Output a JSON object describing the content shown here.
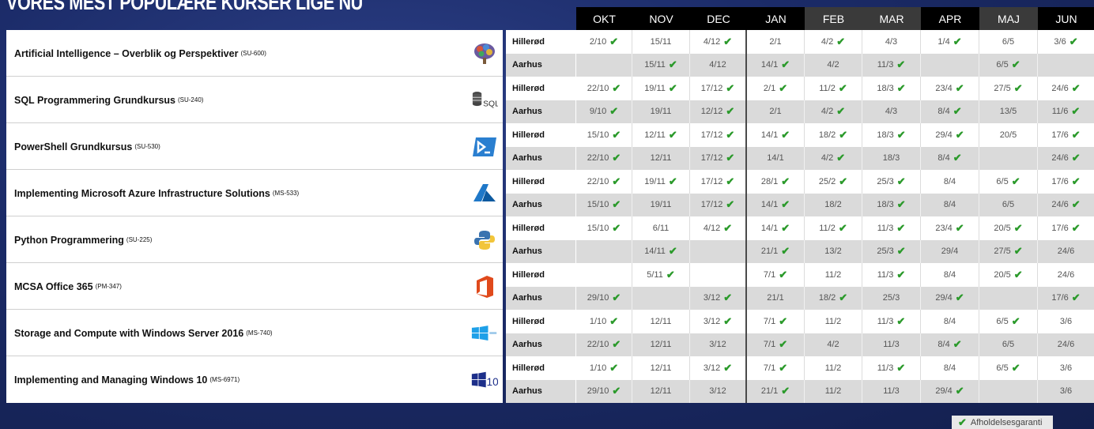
{
  "title": "VORES MEST POPULÆRE KURSER LIGE NU",
  "months": [
    "OKT",
    "NOV",
    "DEC",
    "JAN",
    "FEB",
    "MAR",
    "APR",
    "MAJ",
    "JUN"
  ],
  "check_color": "#2b9a2b",
  "courses": [
    {
      "name": "Artificial Intelligence – Overblik og Perspektiver",
      "code": "(SU-600)",
      "icon": "brain-icon",
      "rows": [
        {
          "loc": "Hillerød",
          "cells": [
            {
              "d": "2/10",
              "c": true
            },
            {
              "d": "15/11",
              "c": false
            },
            {
              "d": "4/12",
              "c": true
            },
            {
              "d": "2/1",
              "c": false
            },
            {
              "d": "4/2",
              "c": true
            },
            {
              "d": "4/3",
              "c": false
            },
            {
              "d": "1/4",
              "c": true
            },
            {
              "d": "6/5",
              "c": false
            },
            {
              "d": "3/6",
              "c": true
            }
          ]
        },
        {
          "loc": "Aarhus",
          "cells": [
            {
              "d": "",
              "c": false
            },
            {
              "d": "15/11",
              "c": true
            },
            {
              "d": "4/12",
              "c": false
            },
            {
              "d": "14/1",
              "c": true
            },
            {
              "d": "4/2",
              "c": false
            },
            {
              "d": "11/3",
              "c": true
            },
            {
              "d": "",
              "c": false
            },
            {
              "d": "6/5",
              "c": true
            },
            {
              "d": "",
              "c": false
            }
          ]
        }
      ]
    },
    {
      "name": "SQL Programmering Grundkursus",
      "code": "(SU-240)",
      "icon": "sql-database-icon",
      "rows": [
        {
          "loc": "Hillerød",
          "cells": [
            {
              "d": "22/10",
              "c": true
            },
            {
              "d": "19/11",
              "c": true
            },
            {
              "d": "17/12",
              "c": true
            },
            {
              "d": "2/1",
              "c": true
            },
            {
              "d": "11/2",
              "c": true
            },
            {
              "d": "18/3",
              "c": true
            },
            {
              "d": "23/4",
              "c": true
            },
            {
              "d": "27/5",
              "c": true
            },
            {
              "d": "24/6",
              "c": true
            }
          ]
        },
        {
          "loc": "Aarhus",
          "cells": [
            {
              "d": "9/10",
              "c": true
            },
            {
              "d": "19/11",
              "c": false
            },
            {
              "d": "12/12",
              "c": true
            },
            {
              "d": "2/1",
              "c": false
            },
            {
              "d": "4/2",
              "c": true
            },
            {
              "d": "4/3",
              "c": false
            },
            {
              "d": "8/4",
              "c": true
            },
            {
              "d": "13/5",
              "c": false
            },
            {
              "d": "11/6",
              "c": true
            }
          ]
        }
      ]
    },
    {
      "name": "PowerShell Grundkursus",
      "code": "(SU-530)",
      "icon": "powershell-icon",
      "rows": [
        {
          "loc": "Hillerød",
          "cells": [
            {
              "d": "15/10",
              "c": true
            },
            {
              "d": "12/11",
              "c": true
            },
            {
              "d": "17/12",
              "c": true
            },
            {
              "d": "14/1",
              "c": true
            },
            {
              "d": "18/2",
              "c": true
            },
            {
              "d": "18/3",
              "c": true
            },
            {
              "d": "29/4",
              "c": true
            },
            {
              "d": "20/5",
              "c": false
            },
            {
              "d": "17/6",
              "c": true
            }
          ]
        },
        {
          "loc": "Aarhus",
          "cells": [
            {
              "d": "22/10",
              "c": true
            },
            {
              "d": "12/11",
              "c": false
            },
            {
              "d": "17/12",
              "c": true
            },
            {
              "d": "14/1",
              "c": false
            },
            {
              "d": "4/2",
              "c": true
            },
            {
              "d": "18/3",
              "c": false
            },
            {
              "d": "8/4",
              "c": true
            },
            {
              "d": "",
              "c": false
            },
            {
              "d": "24/6",
              "c": true
            }
          ]
        }
      ]
    },
    {
      "name": "Implementing Microsoft Azure Infrastructure Solutions",
      "code": "(MS-533)",
      "icon": "azure-icon",
      "rows": [
        {
          "loc": "Hillerød",
          "cells": [
            {
              "d": "22/10",
              "c": true
            },
            {
              "d": "19/11",
              "c": true
            },
            {
              "d": "17/12",
              "c": true
            },
            {
              "d": "28/1",
              "c": true
            },
            {
              "d": "25/2",
              "c": true
            },
            {
              "d": "25/3",
              "c": true
            },
            {
              "d": "8/4",
              "c": false
            },
            {
              "d": "6/5",
              "c": true
            },
            {
              "d": "17/6",
              "c": true
            }
          ]
        },
        {
          "loc": "Aarhus",
          "cells": [
            {
              "d": "15/10",
              "c": true
            },
            {
              "d": "19/11",
              "c": false
            },
            {
              "d": "17/12",
              "c": true
            },
            {
              "d": "14/1",
              "c": true
            },
            {
              "d": "18/2",
              "c": false
            },
            {
              "d": "18/3",
              "c": true
            },
            {
              "d": "8/4",
              "c": false
            },
            {
              "d": "6/5",
              "c": false
            },
            {
              "d": "24/6",
              "c": true
            }
          ]
        }
      ]
    },
    {
      "name": "Python Programmering",
      "code": "(SU-225)",
      "icon": "python-icon",
      "rows": [
        {
          "loc": "Hillerød",
          "cells": [
            {
              "d": "15/10",
              "c": true
            },
            {
              "d": "6/11",
              "c": false
            },
            {
              "d": "4/12",
              "c": true
            },
            {
              "d": "14/1",
              "c": true
            },
            {
              "d": "11/2",
              "c": true
            },
            {
              "d": "11/3",
              "c": true
            },
            {
              "d": "23/4",
              "c": true
            },
            {
              "d": "20/5",
              "c": true
            },
            {
              "d": "17/6",
              "c": true
            }
          ]
        },
        {
          "loc": "Aarhus",
          "cells": [
            {
              "d": "",
              "c": false
            },
            {
              "d": "14/11",
              "c": true
            },
            {
              "d": "",
              "c": false
            },
            {
              "d": "21/1",
              "c": true
            },
            {
              "d": "13/2",
              "c": false
            },
            {
              "d": "25/3",
              "c": true
            },
            {
              "d": "29/4",
              "c": false
            },
            {
              "d": "27/5",
              "c": true
            },
            {
              "d": "24/6",
              "c": false
            }
          ]
        }
      ]
    },
    {
      "name": "MCSA Office 365",
      "code": "(PM-347)",
      "icon": "office-icon",
      "rows": [
        {
          "loc": "Hillerød",
          "cells": [
            {
              "d": "",
              "c": false
            },
            {
              "d": "5/11",
              "c": true
            },
            {
              "d": "",
              "c": false
            },
            {
              "d": "7/1",
              "c": true
            },
            {
              "d": "11/2",
              "c": false
            },
            {
              "d": "11/3",
              "c": true
            },
            {
              "d": "8/4",
              "c": false
            },
            {
              "d": "20/5",
              "c": true
            },
            {
              "d": "24/6",
              "c": false
            }
          ]
        },
        {
          "loc": "Aarhus",
          "cells": [
            {
              "d": "29/10",
              "c": true
            },
            {
              "d": "",
              "c": false
            },
            {
              "d": "3/12",
              "c": true
            },
            {
              "d": "21/1",
              "c": false
            },
            {
              "d": "18/2",
              "c": true
            },
            {
              "d": "25/3",
              "c": false
            },
            {
              "d": "29/4",
              "c": true
            },
            {
              "d": "",
              "c": false
            },
            {
              "d": "17/6",
              "c": true
            }
          ]
        }
      ]
    },
    {
      "name": "Storage and Compute with Windows Server 2016",
      "code": "(MS-740)",
      "icon": "windows-server-icon",
      "rows": [
        {
          "loc": "Hillerød",
          "cells": [
            {
              "d": "1/10",
              "c": true
            },
            {
              "d": "12/11",
              "c": false
            },
            {
              "d": "3/12",
              "c": true
            },
            {
              "d": "7/1",
              "c": true
            },
            {
              "d": "11/2",
              "c": false
            },
            {
              "d": "11/3",
              "c": true
            },
            {
              "d": "8/4",
              "c": false
            },
            {
              "d": "6/5",
              "c": true
            },
            {
              "d": "3/6",
              "c": false
            }
          ]
        },
        {
          "loc": "Aarhus",
          "cells": [
            {
              "d": "22/10",
              "c": true
            },
            {
              "d": "12/11",
              "c": false
            },
            {
              "d": "3/12",
              "c": false
            },
            {
              "d": "7/1",
              "c": true
            },
            {
              "d": "4/2",
              "c": false
            },
            {
              "d": "11/3",
              "c": false
            },
            {
              "d": "8/4",
              "c": true
            },
            {
              "d": "6/5",
              "c": false
            },
            {
              "d": "24/6",
              "c": false
            }
          ]
        }
      ]
    },
    {
      "name": "Implementing and Managing Windows 10",
      "code": "(MS-6971)",
      "icon": "windows-10-icon",
      "rows": [
        {
          "loc": "Hillerød",
          "cells": [
            {
              "d": "1/10",
              "c": true
            },
            {
              "d": "12/11",
              "c": false
            },
            {
              "d": "3/12",
              "c": true
            },
            {
              "d": "7/1",
              "c": true
            },
            {
              "d": "11/2",
              "c": false
            },
            {
              "d": "11/3",
              "c": true
            },
            {
              "d": "8/4",
              "c": false
            },
            {
              "d": "6/5",
              "c": true
            },
            {
              "d": "3/6",
              "c": false
            }
          ]
        },
        {
          "loc": "Aarhus",
          "cells": [
            {
              "d": "29/10",
              "c": true
            },
            {
              "d": "12/11",
              "c": false
            },
            {
              "d": "3/12",
              "c": false
            },
            {
              "d": "21/1",
              "c": true
            },
            {
              "d": "11/2",
              "c": false
            },
            {
              "d": "11/3",
              "c": false
            },
            {
              "d": "29/4",
              "c": true
            },
            {
              "d": "",
              "c": false
            },
            {
              "d": "3/6",
              "c": false
            }
          ]
        }
      ]
    }
  ],
  "legend": {
    "icon": "checkmark-icon",
    "label": "Afholdelsesgaranti"
  }
}
